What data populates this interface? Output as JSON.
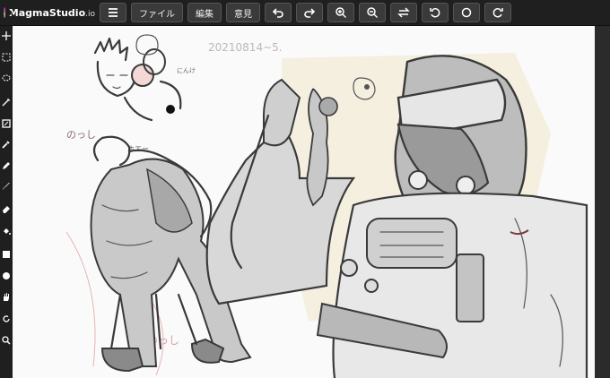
{
  "app": {
    "name": "MagmaStudio",
    "name_suffix": ".io"
  },
  "toolbar": {
    "menu_icon": "hamburger-menu-icon",
    "file_label": "ファイル",
    "edit_label": "編集",
    "feedback_label": "意見",
    "buttons": [
      "undo-icon",
      "redo-icon",
      "zoom-in-icon",
      "zoom-out-icon",
      "flip-horizontal-icon",
      "rotate-left-icon",
      "reset-rotation-icon",
      "rotate-right-icon"
    ]
  },
  "tools": [
    "move-icon",
    "select-rect-icon",
    "lasso-icon",
    "magic-wand-icon",
    "transform-icon",
    "eyedropper-icon",
    "pencil-icon",
    "brush-icon",
    "eraser-icon",
    "fill-bucket-icon",
    "rectangle-icon",
    "circle-icon",
    "hand-icon",
    "rotate-view-icon",
    "zoom-icon"
  ],
  "canvas": {
    "date_note": "20210814~5.",
    "sketch_notes": [
      "のっし",
      "のっし",
      "ホエー",
      "にんけ"
    ]
  },
  "colors": {
    "topbar": "#1f1f1f",
    "canvas_bg": "#fafafa",
    "accent_bg": "#f3ecd8"
  }
}
